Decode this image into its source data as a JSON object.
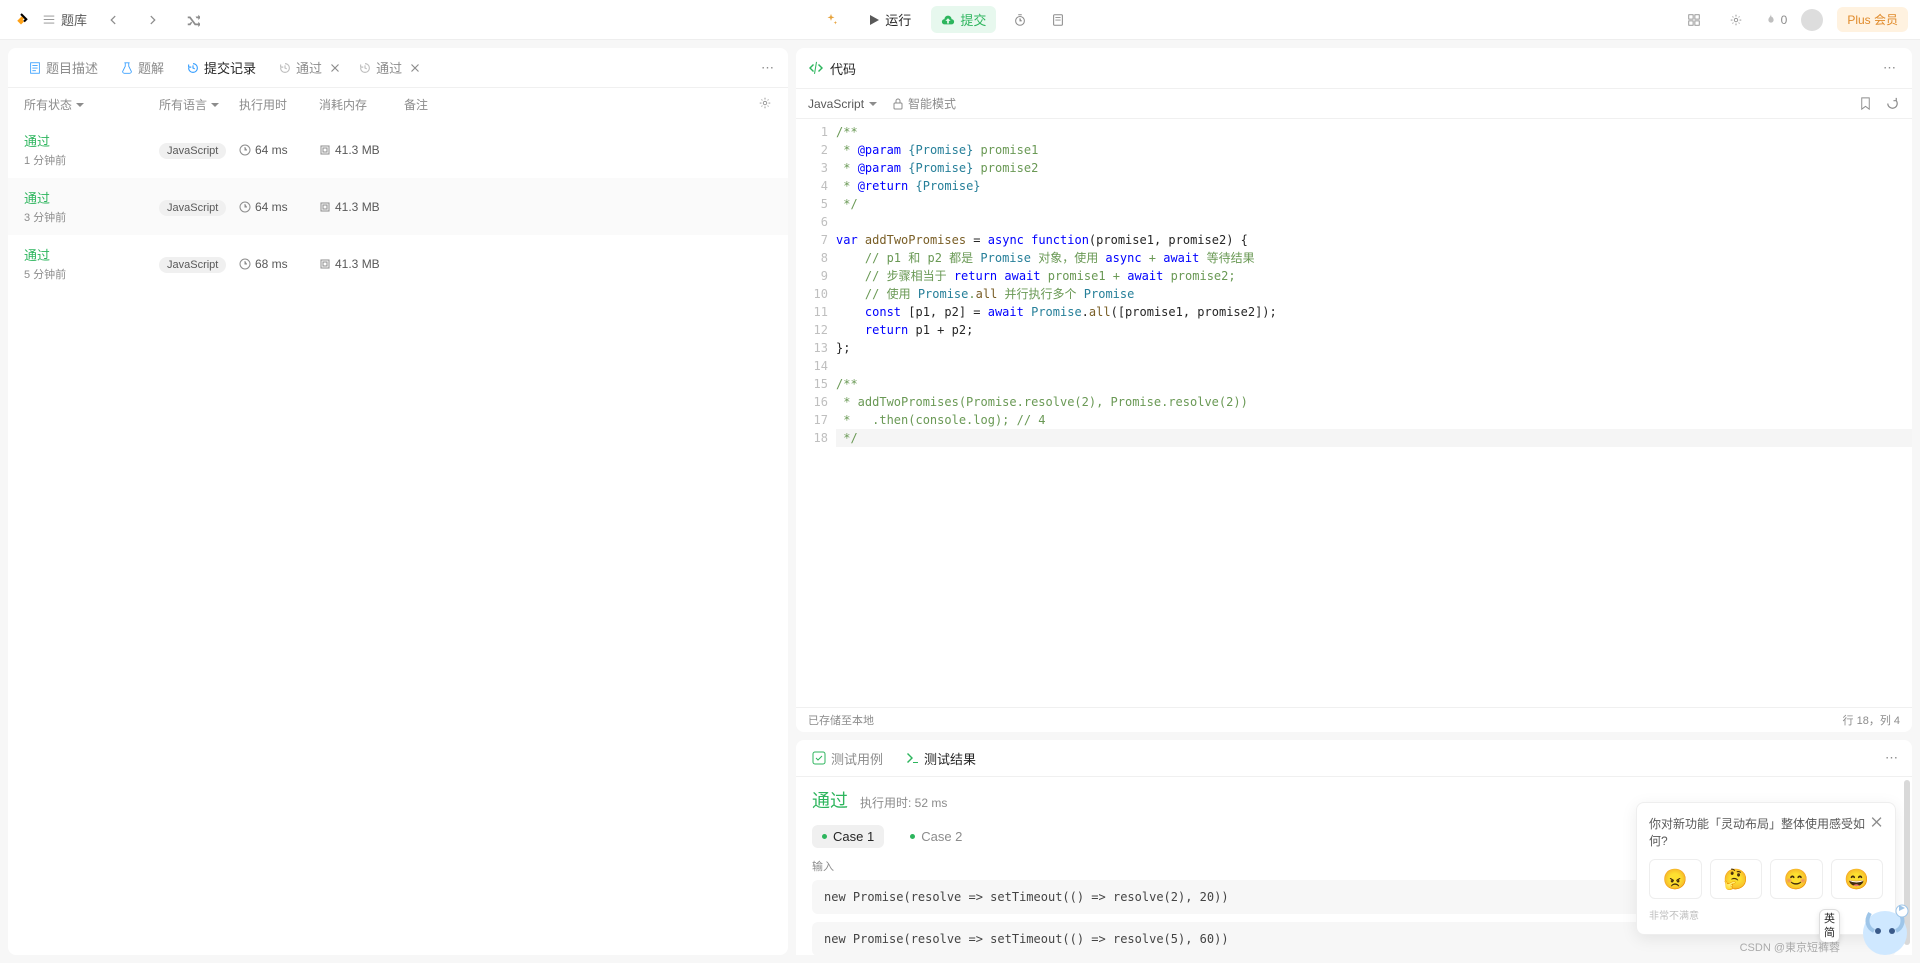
{
  "topbar": {
    "problems": "题库",
    "run": "运行",
    "submit": "提交",
    "fire_count": "0",
    "plus": "Plus 会员"
  },
  "left": {
    "tabs": {
      "desc": "题目描述",
      "solution": "题解",
      "submissions": "提交记录",
      "pass1": "通过",
      "pass2": "通过"
    },
    "headers": {
      "status": "所有状态",
      "lang": "所有语言",
      "time": "执行用时",
      "memory": "消耗内存",
      "notes": "备注"
    },
    "rows": [
      {
        "status": "通过",
        "ago": "1 分钟前",
        "lang": "JavaScript",
        "time": "64 ms",
        "mem": "41.3 MB"
      },
      {
        "status": "通过",
        "ago": "3 分钟前",
        "lang": "JavaScript",
        "time": "64 ms",
        "mem": "41.3 MB"
      },
      {
        "status": "通过",
        "ago": "5 分钟前",
        "lang": "JavaScript",
        "time": "68 ms",
        "mem": "41.3 MB"
      }
    ]
  },
  "code": {
    "title": "代码",
    "language": "JavaScript",
    "smart": "智能模式",
    "saved": "已存储至本地",
    "cursor": "行 18，列 4",
    "lines": [
      "/**",
      " * @param {Promise} promise1",
      " * @param {Promise} promise2",
      " * @return {Promise}",
      " */",
      "",
      "var addTwoPromises = async function(promise1, promise2) {",
      "    // p1 和 p2 都是 Promise 对象，使用 async + await 等待结果",
      "    // 步骤相当于 return await promise1 + await promise2;",
      "    // 使用 Promise.all 并行执行多个 Promise",
      "    const [p1, p2] = await Promise.all([promise1, promise2]);",
      "    return p1 + p2;",
      "};",
      "",
      "/**",
      " * addTwoPromises(Promise.resolve(2), Promise.resolve(2))",
      " *   .then(console.log); // 4",
      " */"
    ]
  },
  "result": {
    "tab_tests": "测试用例",
    "tab_results": "测试结果",
    "pass": "通过",
    "runtime": "执行用时: 52 ms",
    "case1": "Case 1",
    "case2": "Case 2",
    "input_label": "输入",
    "input1": "new Promise(resolve => setTimeout(() => resolve(2), 20))",
    "input2": "new Promise(resolve => setTimeout(() => resolve(5), 60))"
  },
  "feedback": {
    "title": "你对新功能「灵动布局」整体使用感受如何?",
    "foot": "非常不满意",
    "emojis": [
      "😠",
      "🤔",
      "😊",
      "😄"
    ]
  },
  "ime": {
    "top": "英",
    "bottom": "简"
  },
  "watermark": "CSDN @東京短裤蓉"
}
